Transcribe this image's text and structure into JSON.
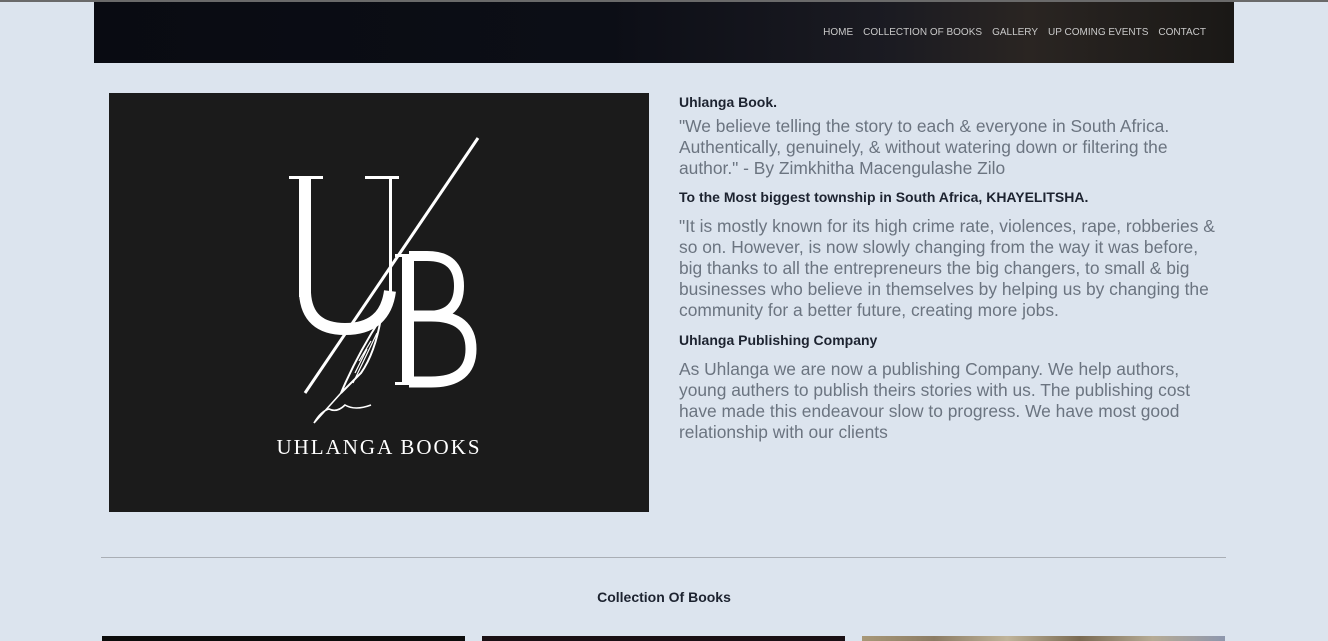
{
  "nav": {
    "items": [
      "HOME",
      "COLLECTION OF BOOKS",
      "GALLERY",
      "UP COMING EVENTS",
      "CONTACT"
    ]
  },
  "logo": {
    "text": "UHLANGA BOOKS"
  },
  "about": {
    "heading1": "Uhlanga Book.",
    "para1": "\"We believe telling the story to each & everyone in South Africa. Authentically, genuinely, & without watering down or filtering the author.\" - By Zimkhitha Macengulashe Zilo",
    "heading2": "To the Most biggest township in South Africa, KHAYELITSHA.",
    "para2": "\"It is mostly known for its high crime rate, violences, rape, robberies & so on. However, is now slowly changing from the way it was before, big thanks to all the entrepreneurs the big changers, to small & big businesses who believe in themselves by helping us by changing the community for a better future, creating more jobs.",
    "heading3": "Uhlanga Publishing Company",
    "para3": "As Uhlanga we are now a publishing Company. We help authors, young authers to publish theirs stories with us. The publishing cost have made this endeavour slow to progress. We have most good relationship with our clients"
  },
  "collection": {
    "title": "Collection Of Books"
  }
}
